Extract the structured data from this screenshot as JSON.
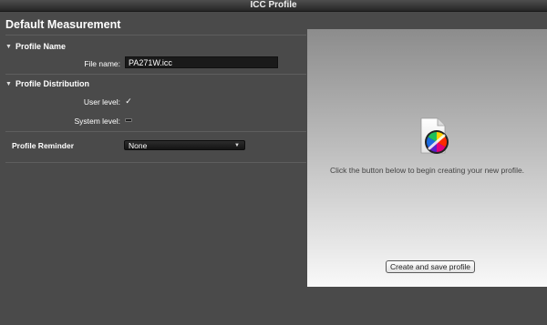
{
  "window": {
    "title": "ICC Profile"
  },
  "main_title": "Default Measurement",
  "profile_name": {
    "header": "Profile Name",
    "file_name_label": "File name:",
    "file_name_value": "PA271W.icc"
  },
  "profile_distribution": {
    "header": "Profile Distribution",
    "user_level_label": "User level:",
    "user_level_checked": true,
    "user_level_mark": "✓",
    "system_level_label": "System level:",
    "system_level_checked": false
  },
  "profile_reminder": {
    "label": "Profile Reminder",
    "selected": "None"
  },
  "preview": {
    "instruction": "Click the button below to begin creating your new profile.",
    "create_button": "Create and save profile",
    "icon": "color-wheel-document-icon"
  },
  "colors": {
    "background": "#4a4a4a",
    "titlebar": "#2a2a2a",
    "panel_top": "#8c8c8c",
    "panel_bottom": "#f9f9f9"
  }
}
